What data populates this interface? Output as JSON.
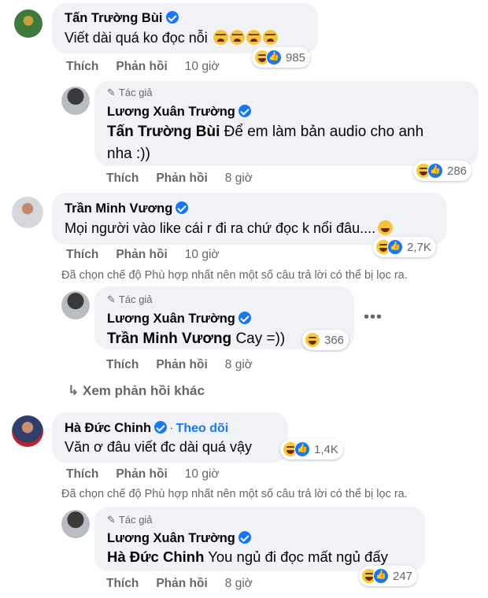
{
  "colors": {
    "accent": "#1877f2",
    "bubble": "#f0f2f5",
    "muted": "#65676b"
  },
  "labels": {
    "like": "Thích",
    "reply": "Phản hồi",
    "author_badge": "Tác giả",
    "follow": "Theo dõi",
    "see_more": "Xem phản hồi khác",
    "filter_note": "Đã chọn chế độ Phù hợp nhất nên một số câu trả lời có thể bị lọc ra."
  },
  "c1": {
    "author": "Tấn Trường Bùi",
    "text": "Viết dài quá ko đọc nỗi",
    "reactions": "985",
    "time": "10 giờ"
  },
  "r1": {
    "author": "Lương Xuân Trường",
    "tag": "Tấn Trường Bùi",
    "text1": "Để em làm bản audio cho anh",
    "text2": "nha :))",
    "reactions": "286",
    "time": "8 giờ"
  },
  "c2": {
    "author": "Trần Minh Vương",
    "text": "Mọi người vào like cái r đi ra chứ đọc k nổi đâu....",
    "reactions": "2,7K",
    "time": "10 giờ"
  },
  "r2": {
    "author": "Lương Xuân Trường",
    "tag": "Trần Minh Vương",
    "text": "Cay =))",
    "reactions": "366",
    "time": "8 giờ"
  },
  "c3": {
    "author": "Hà Đức Chinh",
    "text": "Văn ơ đâu viết đc dài quá vậy",
    "reactions": "1,4K",
    "time": "10 giờ"
  },
  "r3": {
    "author": "Lương Xuân Trường",
    "tag": "Hà Đức Chinh",
    "text": "You ngủ đi đọc mất ngủ đấy",
    "reactions": "247",
    "time": "8 giờ"
  }
}
